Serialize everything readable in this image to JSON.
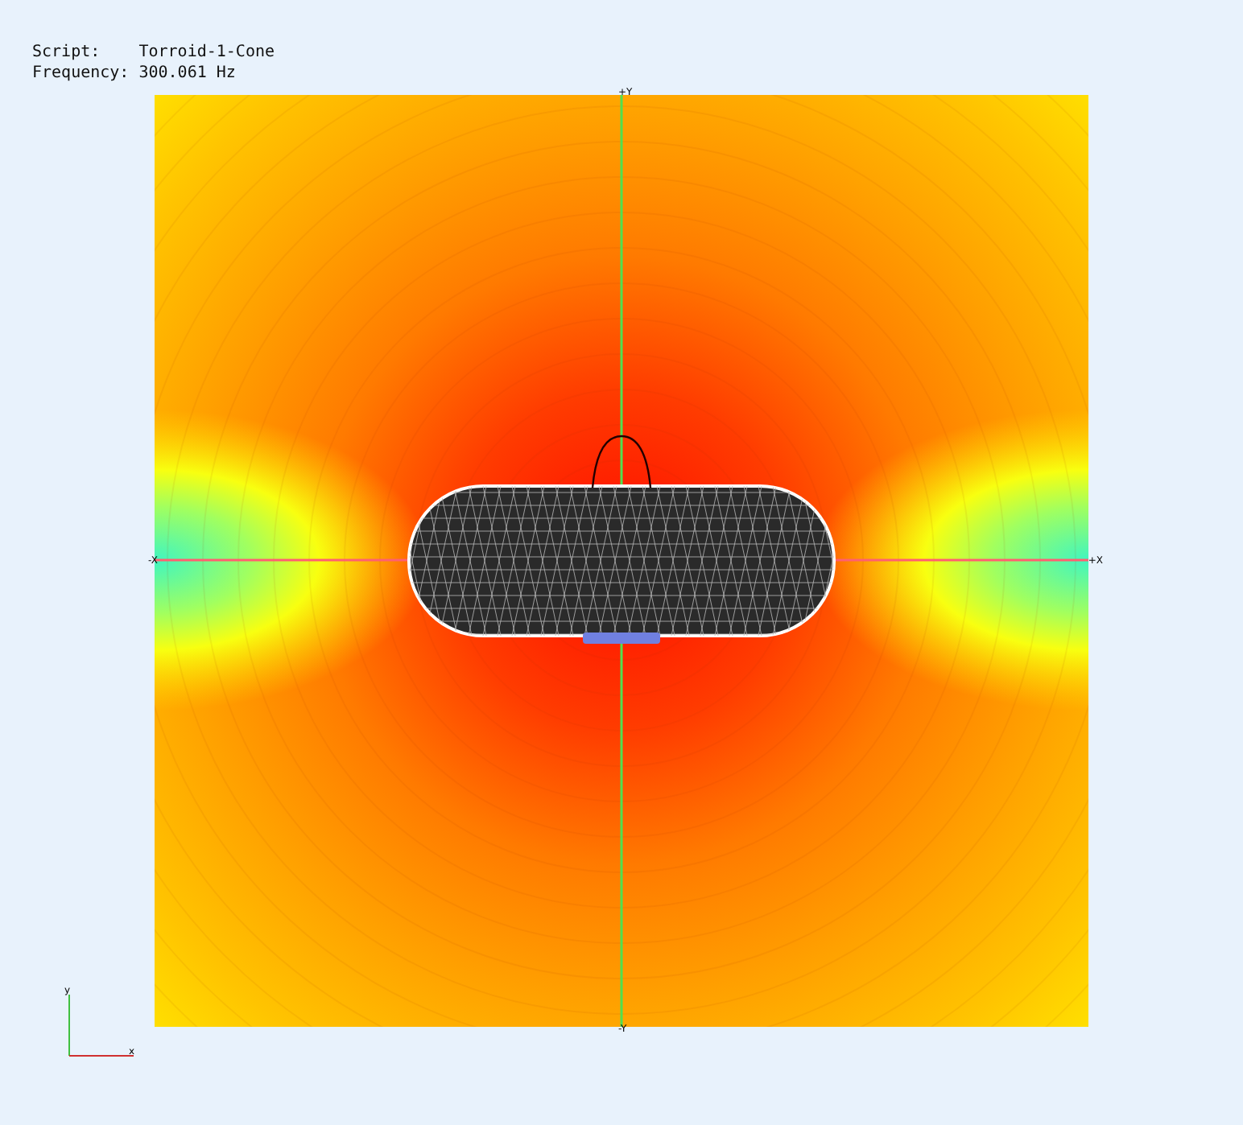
{
  "info": [
    {
      "label": "Script:",
      "value": "Torroid-1-Cone"
    },
    {
      "label": "Frequency:",
      "value": "300.061 Hz"
    }
  ],
  "plot": {
    "axis_labels": {
      "top": "+Y",
      "bottom": "-Y",
      "left": "-X",
      "right": "+X"
    }
  },
  "triad": {
    "y_label": "y",
    "x_label": "x"
  }
}
